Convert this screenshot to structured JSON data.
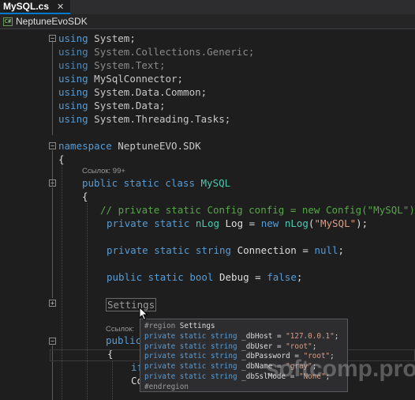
{
  "tab": {
    "title": "MySQL.cs",
    "close": "✕"
  },
  "nav": {
    "project": "NeptuneEvoSDK",
    "project_icon": "C#"
  },
  "code": {
    "l1": {
      "kw": "using",
      "ns": "System;"
    },
    "l2": {
      "kw": "using",
      "ns": "System.Collections.Generic;"
    },
    "l3": {
      "kw": "using",
      "ns": "System.Text;"
    },
    "l4": {
      "kw": "using",
      "ns": "MySqlConnector;"
    },
    "l5": {
      "kw": "using",
      "ns": "System.Data.Common;"
    },
    "l6": {
      "kw": "using",
      "ns": "System.Data;"
    },
    "l7": {
      "kw": "using",
      "ns": "System.Threading.Tasks;"
    },
    "l8": {
      "kw": "namespace",
      "ns": "NeptuneEVO.SDK"
    },
    "l9": "{",
    "lens1": "Ссылок: 99+",
    "l10": {
      "kw": "public static class",
      "type": "MySQL"
    },
    "l11": "{",
    "l12": "// private static Config config = new Config(\"MySQL\");",
    "l13": {
      "kw1": "private static",
      "type1": "nLog",
      "name": "Log",
      "eq": "=",
      "kw2": "new",
      "type2": "nLog",
      "open": "(",
      "str": "\"MySQL\"",
      "close": ");"
    },
    "l14": {
      "kw": "private static string",
      "name": "Connection",
      "eq": "=",
      "val": "null",
      "end": ";"
    },
    "l15": {
      "kw": "public static bool",
      "name": "Debug",
      "eq": "=",
      "val": "false",
      "end": ";"
    },
    "l16": "Settings",
    "lens2": "Ссылок:",
    "l17": "public",
    "l18": "{",
    "l19": "if",
    "l20": "Co"
  },
  "tooltip": {
    "header_kw": "#region",
    "header_name": "Settings",
    "lines": [
      {
        "kw": "private static string",
        "name": "_dbHost",
        "eq": "=",
        "str": "\"127.0.0.1\"",
        "end": ";"
      },
      {
        "kw": "private static string",
        "name": "_dbUser",
        "eq": "=",
        "str": "\"root\"",
        "end": ";"
      },
      {
        "kw": "private static string",
        "name": "_dbPassword",
        "eq": "=",
        "str": "\"root\"",
        "end": ";"
      },
      {
        "kw": "private static string",
        "name": "_dbName",
        "eq": "=",
        "str": "\"gray\"",
        "end": ";"
      },
      {
        "kw": "private static string",
        "name": "_dbSslMode",
        "eq": "=",
        "str": "\"None\"",
        "end": ";"
      }
    ],
    "footer": "#endregion"
  },
  "watermark": "softcomp.pro",
  "colors": {
    "background": "#1e1e1e",
    "keyword": "#569cd6",
    "type": "#4ec9b0",
    "string": "#d69d85",
    "comment": "#57a64a",
    "accent": "#007acc"
  }
}
